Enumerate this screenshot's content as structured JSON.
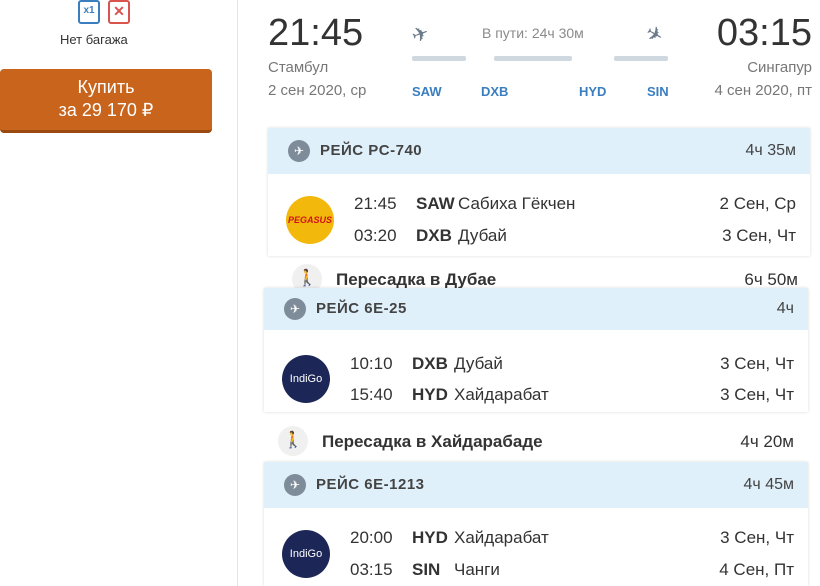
{
  "sidebar": {
    "baggage_icon_label": "x1",
    "baggage_text": "Нет багажа",
    "buy_line1": "Купить",
    "buy_line2": "за 29 170 ₽"
  },
  "summary": {
    "dep_time": "21:45",
    "dep_city": "Стамбул",
    "dep_date": "2 сен 2020, ср",
    "arr_time": "03:15",
    "arr_city": "Сингапур",
    "arr_date": "4 сен 2020, пт",
    "transit": "В пути: 24ч 30м",
    "codes": [
      "SAW",
      "DXB",
      "HYD",
      "SIN"
    ]
  },
  "segments": [
    {
      "title": "РЕЙС PC-740",
      "duration": "4ч 35м",
      "airline": "PEGASUS",
      "legs": [
        {
          "time": "21:45",
          "code": "SAW",
          "city": "Сабиха Гёкчен",
          "date": "2 Сен, Ср"
        },
        {
          "time": "03:20",
          "code": "DXB",
          "city": "Дубай",
          "date": "3 Сен, Чт"
        }
      ]
    },
    {
      "title": "РЕЙС 6E-25",
      "duration": "4ч",
      "airline": "IndiGo",
      "legs": [
        {
          "time": "10:10",
          "code": "DXB",
          "city": "Дубай",
          "date": "3 Сен, Чт"
        },
        {
          "time": "15:40",
          "code": "HYD",
          "city": "Хайдарабат",
          "date": "3 Сен, Чт"
        }
      ]
    },
    {
      "title": "РЕЙС 6E-1213",
      "duration": "4ч 45м",
      "airline": "IndiGo",
      "legs": [
        {
          "time": "20:00",
          "code": "HYD",
          "city": "Хайдарабат",
          "date": "3 Сен, Чт"
        },
        {
          "time": "03:15",
          "code": "SIN",
          "city": "Чанги",
          "date": "4 Сен, Пт"
        }
      ]
    }
  ],
  "transfers": [
    {
      "label": "Пересадка в Дубае",
      "duration": "6ч 50м"
    },
    {
      "label": "Пересадка в Хайдарабаде",
      "duration": "4ч 20м"
    }
  ],
  "colors": {
    "buy_button": "#c8641b",
    "header_bg": "#dff0fa",
    "code_blue": "#3a7ec0"
  }
}
